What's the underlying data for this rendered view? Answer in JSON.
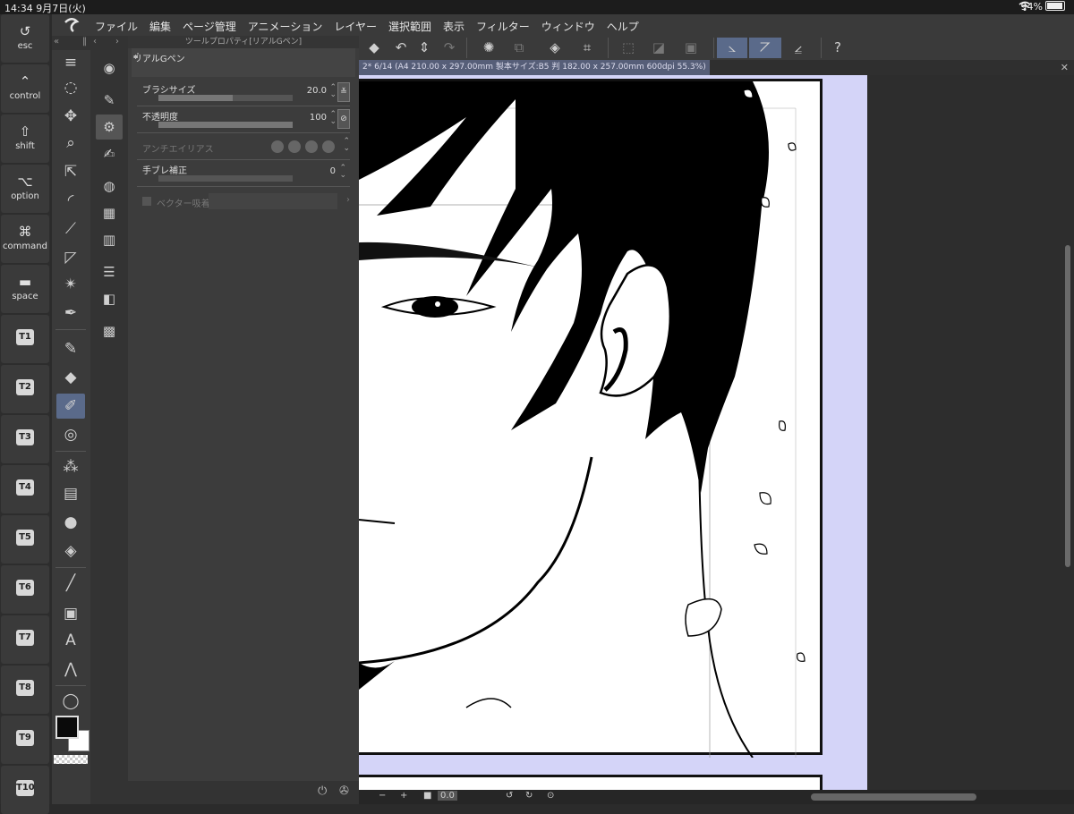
{
  "status_bar": {
    "time": "14:34",
    "date": "9月7日(火)",
    "battery": "94%"
  },
  "menu": {
    "items": [
      "ファイル",
      "編集",
      "ページ管理",
      "アニメーション",
      "レイヤー",
      "選択範囲",
      "表示",
      "フィルター",
      "ウィンドウ",
      "ヘルプ"
    ]
  },
  "modifier_keys": [
    {
      "symbol": "↺",
      "label": "esc"
    },
    {
      "symbol": "⌃",
      "label": "control"
    },
    {
      "symbol": "⇧",
      "label": "shift"
    },
    {
      "symbol": "⌥",
      "label": "option"
    },
    {
      "symbol": "⌘",
      "label": "command"
    },
    {
      "symbol": "▬",
      "label": "space"
    }
  ],
  "t_keys": [
    "T1",
    "T2",
    "T3",
    "T4",
    "T5",
    "T6",
    "T7",
    "T8",
    "T9",
    "T10"
  ],
  "tool_property": {
    "panel_title": "ツールプロパティ[リアルGペン]",
    "subtool_name": "リアルGペン",
    "brush_size": {
      "label": "ブラシサイズ",
      "value": "20.0",
      "fill": 0.55
    },
    "opacity": {
      "label": "不透明度",
      "value": "100",
      "fill": 1.0
    },
    "antialias": {
      "label": "アンチエイリアス"
    },
    "stabilization": {
      "label": "手ブレ補正",
      "value": "0",
      "fill": 0.0
    },
    "vector_snap": {
      "label": "ベクター吸着"
    }
  },
  "document": {
    "tab_label": "2* 6/14 (A4 210.00 x 297.00mm 製本サイズ:B5 判 182.00 x 257.00mm 600dpi 55.3%)"
  },
  "footer": {
    "zoom_value": "0.0",
    "minus": "−",
    "plus": "+"
  },
  "colors": {
    "accent": "#5a6a8a",
    "canvas_bg": "#d4d4f8",
    "panel": "#3c3c3c"
  }
}
